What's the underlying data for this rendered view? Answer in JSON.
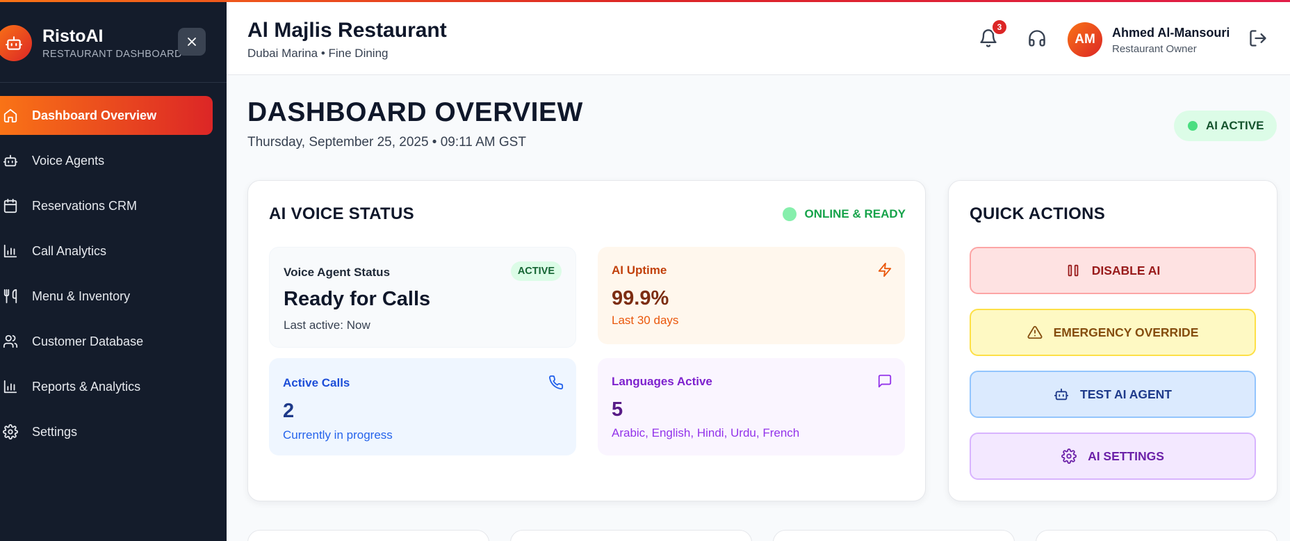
{
  "brand": {
    "name": "RistoAI",
    "subtitle": "RESTAURANT DASHBOARD"
  },
  "sidebar": {
    "items": [
      {
        "label": "Dashboard Overview",
        "icon": "home-icon",
        "active": true
      },
      {
        "label": "Voice Agents",
        "icon": "robot-icon"
      },
      {
        "label": "Reservations CRM",
        "icon": "calendar-icon"
      },
      {
        "label": "Call Analytics",
        "icon": "bar-chart-icon"
      },
      {
        "label": "Menu & Inventory",
        "icon": "utensils-icon"
      },
      {
        "label": "Customer Database",
        "icon": "users-icon"
      },
      {
        "label": "Reports & Analytics",
        "icon": "bar-chart-icon"
      },
      {
        "label": "Settings",
        "icon": "gear-icon"
      }
    ]
  },
  "header": {
    "restaurant_name": "Al Majlis Restaurant",
    "restaurant_sub": "Dubai Marina • Fine Dining",
    "notification_count": "3",
    "user": {
      "initials": "AM",
      "name": "Ahmed Al-Mansouri",
      "role": "Restaurant Owner"
    }
  },
  "page": {
    "title": "DASHBOARD OVERVIEW",
    "date": "Thursday, September 25, 2025 • 09:11 AM GST",
    "ai_status_badge": "AI ACTIVE"
  },
  "voice_status": {
    "title": "AI VOICE STATUS",
    "online_label": "ONLINE & READY",
    "agent": {
      "label": "Voice Agent Status",
      "badge": "ACTIVE",
      "value": "Ready for Calls",
      "sub": "Last active: Now"
    },
    "uptime": {
      "label": "AI Uptime",
      "value": "99.9%",
      "sub": "Last 30 days"
    },
    "active_calls": {
      "label": "Active Calls",
      "value": "2",
      "sub": "Currently in progress"
    },
    "languages": {
      "label": "Languages Active",
      "value": "5",
      "sub": "Arabic, English, Hindi, Urdu, French"
    }
  },
  "quick_actions": {
    "title": "QUICK ACTIONS",
    "buttons": [
      {
        "label": "DISABLE AI",
        "icon": "pause-icon"
      },
      {
        "label": "EMERGENCY OVERRIDE",
        "icon": "warning-icon"
      },
      {
        "label": "TEST AI AGENT",
        "icon": "robot-icon"
      },
      {
        "label": "AI SETTINGS",
        "icon": "gear-icon"
      }
    ]
  },
  "colors": {
    "accent_start": "#f97316",
    "accent_end": "#dc2626",
    "sidebar_bg": "#141c2b",
    "online_green": "#16a34a"
  }
}
